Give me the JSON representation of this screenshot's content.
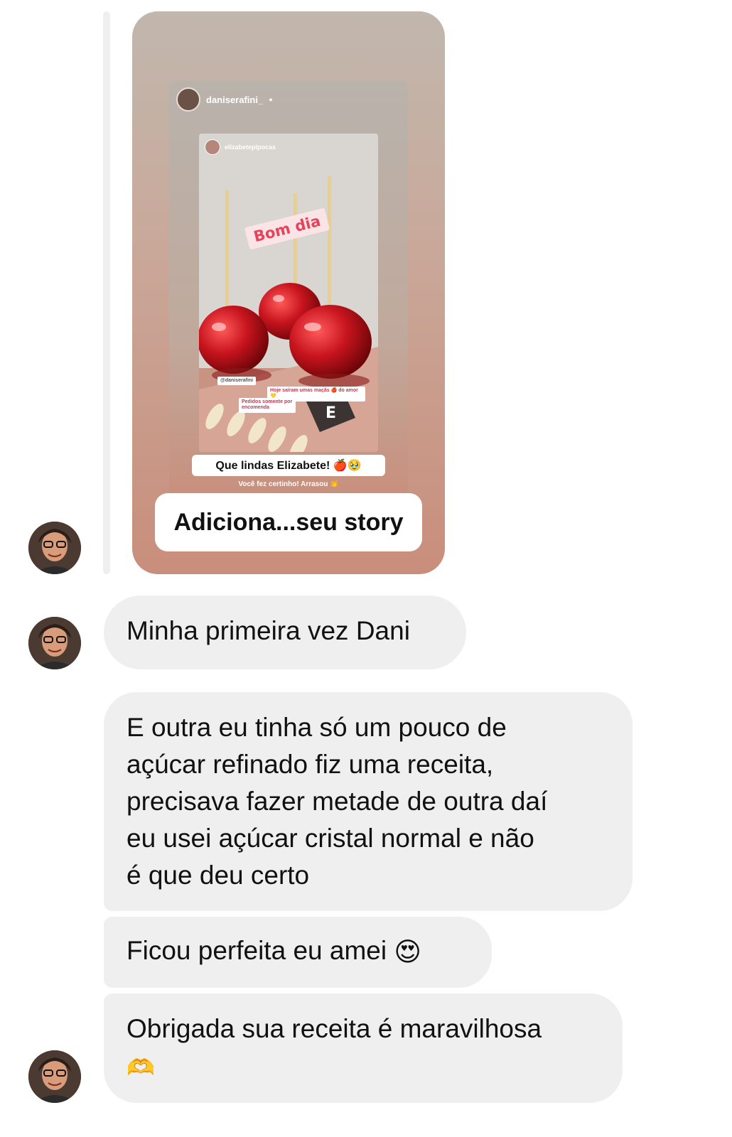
{
  "story_reply": {
    "outer_username": "daniserafini_",
    "nested_username": "elizabetepipocas",
    "sticker_text": "Bom dia",
    "small_caption_1": "Hoje saíram umas maçãs 🍎 do amor 💛",
    "small_caption_2": "Pedidos somente por encomenda",
    "handle_tag": "@daniserafini",
    "main_caption": "Que lindas Elizabete! 🍎🥹",
    "sub_caption": "Você fez certinho! Arrasou 👏",
    "add_story_label": "Adiciona...seu story"
  },
  "messages": [
    {
      "text": "Minha primeira vez Dani"
    },
    {
      "text": "E outra eu tinha só um pouco de\naçúcar refinado fiz uma receita,\nprecisava fazer metade de outra daí\neu usei açúcar cristal normal e não\né que deu certo"
    },
    {
      "text": "Ficou perfeita eu amei",
      "emoji": "😍"
    },
    {
      "text": "Obrigada sua receita é maravilhosa",
      "emoji": "🫶"
    }
  ],
  "colors": {
    "bubble_bg": "#efefef",
    "story_gradient_top": "#c1b7ad",
    "story_gradient_bottom": "#c98e7b",
    "candy_apple_red": "#c8141e"
  }
}
